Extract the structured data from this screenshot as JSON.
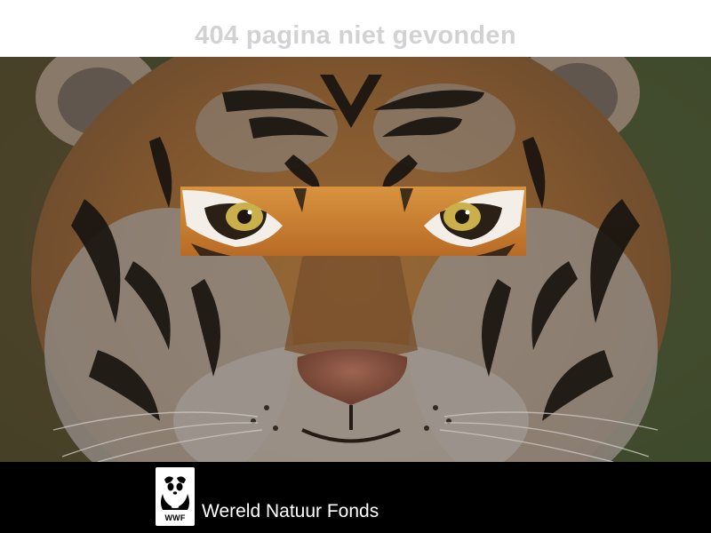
{
  "page": {
    "title": "404 pagina niet gevonden",
    "title_color": "#d2d2d2"
  },
  "hero": {
    "icon": "tiger-face-image",
    "highlight": "tiger-eyes-strip"
  },
  "footer": {
    "logo_icon": "wwf-panda-icon",
    "logo_text": "WWF",
    "org_name": "Wereld Natuur Fonds",
    "background": "#000000"
  }
}
